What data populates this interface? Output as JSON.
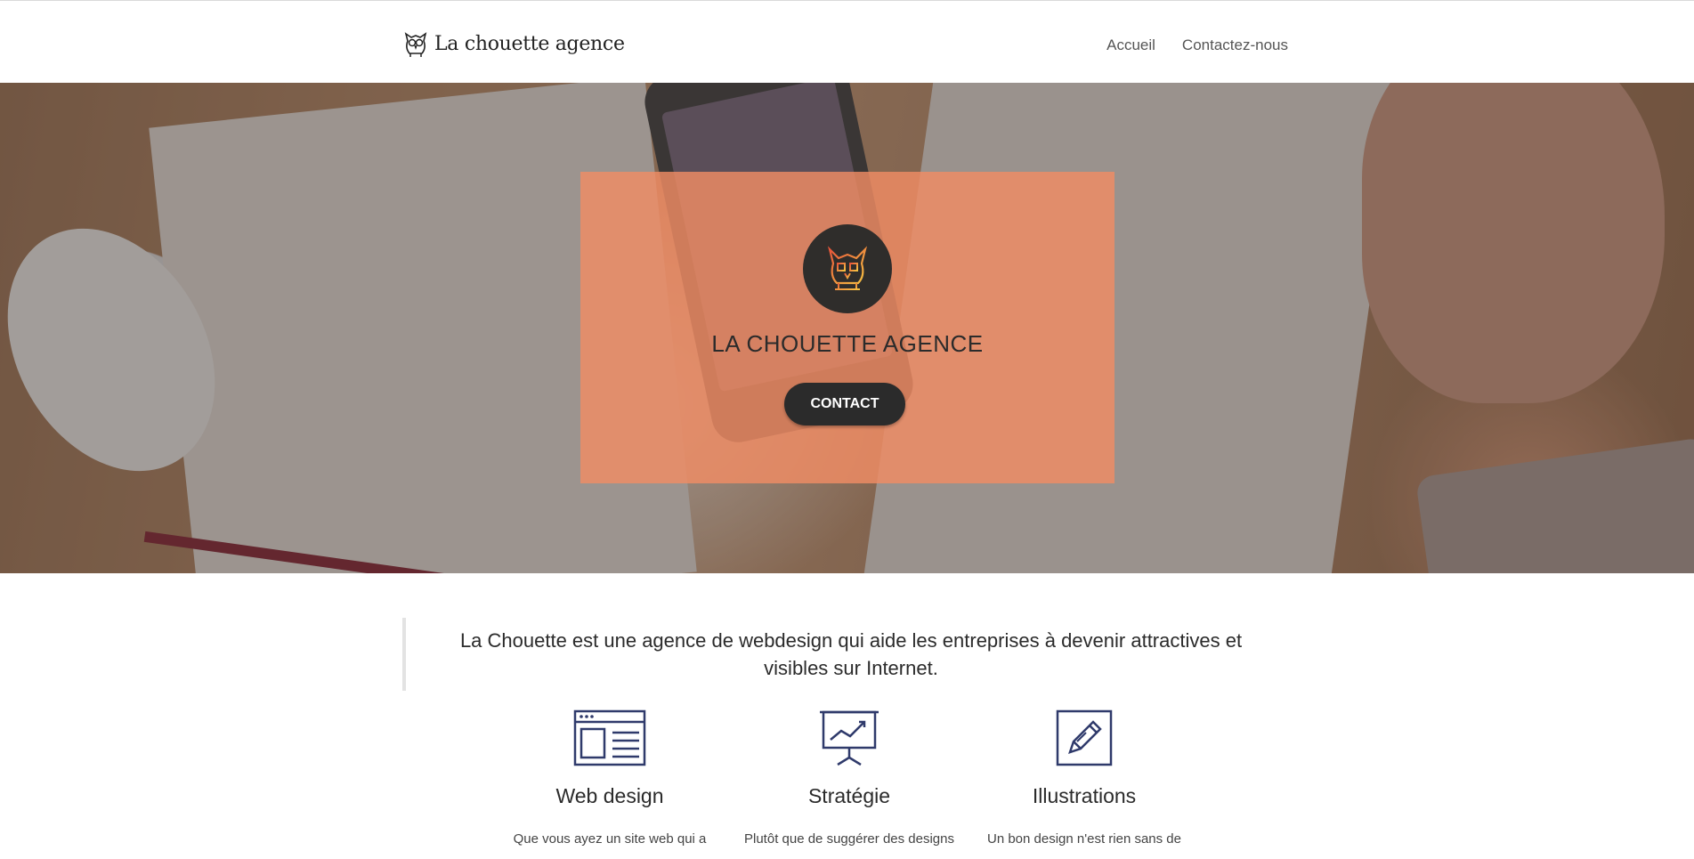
{
  "header": {
    "brand_name": "La chouette agence",
    "nav": [
      {
        "label": "Accueil"
      },
      {
        "label": "Contactez-nous"
      }
    ]
  },
  "hero": {
    "title": "LA CHOUETTE AGENCE",
    "button_label": "CONTACT",
    "card_color": "#f08c64"
  },
  "intro": {
    "text": "La Chouette est une agence de webdesign qui aide les entreprises à devenir attractives et visibles sur Internet."
  },
  "services": [
    {
      "icon": "web-design-icon",
      "title": "Web design",
      "text": "Que vous ayez un site web qui a"
    },
    {
      "icon": "strategy-icon",
      "title": "Stratégie",
      "text": "Plutôt que de suggérer des designs"
    },
    {
      "icon": "illustration-icon",
      "title": "Illustrations",
      "text": "Un bon design n'est rien sans de"
    }
  ],
  "colors": {
    "icon": "#2f3a6b",
    "text": "#2b2b2b"
  }
}
